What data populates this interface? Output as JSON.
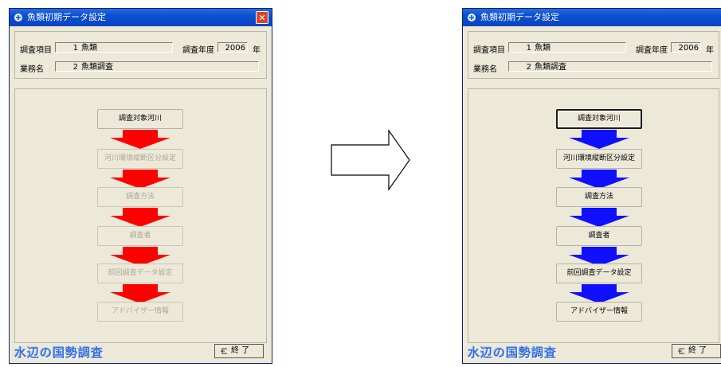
{
  "colors": {
    "disabled_arrow": "#ff0000",
    "enabled_arrow": "#1010ff",
    "title_bar": "#0a4fd0",
    "brand": "#3a6fd6"
  },
  "before": {
    "title": "魚類初期データ設定",
    "close": "✕",
    "info": {
      "item_label": "調査項目",
      "item_number": "1",
      "item_value": "魚類",
      "year_label": "調査年度",
      "year_value": "2006",
      "year_unit": "年",
      "business_label": "業務名",
      "business_number": "2",
      "business_value": "魚類調査"
    },
    "buttons": [
      "調査対象河川",
      "河川環境縦断区分設定",
      "調査方法",
      "調査者",
      "前回調査データ設定",
      "アドバイザー情報"
    ],
    "brand": "水辺の国勢調査",
    "exit_label": "終 了"
  },
  "after": {
    "title": "魚類初期データ設定",
    "info": {
      "item_label": "調査項目",
      "item_number": "1",
      "item_value": "魚類",
      "year_label": "調査年度",
      "year_value": "2006",
      "year_unit": "年",
      "business_label": "業務名",
      "business_number": "2",
      "business_value": "魚類調査"
    },
    "buttons": [
      "調査対象河川",
      "河川環境縦断区分設定",
      "調査方法",
      "調査者",
      "前回調査データ設定",
      "アドバイザー情報"
    ],
    "brand": "水辺の国勢調査",
    "exit_label": "終 了"
  }
}
